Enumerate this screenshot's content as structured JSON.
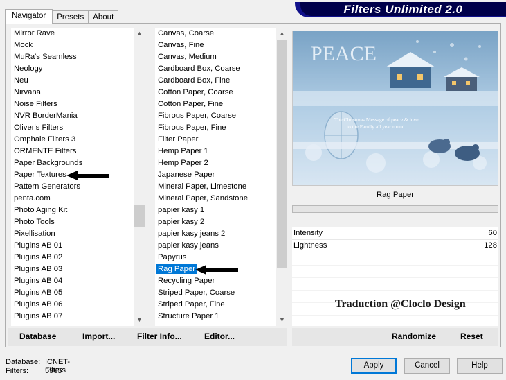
{
  "tabs": [
    "Navigator",
    "Presets",
    "About"
  ],
  "app_title": "Filters Unlimited 2.0",
  "categories": [
    "Mirror Rave",
    "Mock",
    "MuRa's Seamless",
    "Neology",
    "Neu",
    "Nirvana",
    "Noise Filters",
    "NVR BorderMania",
    "Oliver's Filters",
    "Omphale Filters 3",
    "ORMENTE Filters",
    "Paper Backgrounds",
    "Paper Textures",
    "Pattern Generators",
    "penta.com",
    "Photo Aging Kit",
    "Photo Tools",
    "Pixellisation",
    "Plugins AB 01",
    "Plugins AB 02",
    "Plugins AB 03",
    "Plugins AB 04",
    "Plugins AB 05",
    "Plugins AB 06",
    "Plugins AB 07"
  ],
  "filters": [
    "Canvas, Coarse",
    "Canvas, Fine",
    "Canvas, Medium",
    "Cardboard Box, Coarse",
    "Cardboard Box, Fine",
    "Cotton Paper, Coarse",
    "Cotton Paper, Fine",
    "Fibrous Paper, Coarse",
    "Fibrous Paper, Fine",
    "Filter Paper",
    "Hemp Paper 1",
    "Hemp Paper 2",
    "Japanese Paper",
    "Mineral Paper, Limestone",
    "Mineral Paper, Sandstone",
    "papier kasy 1",
    "papier kasy 2",
    "papier kasy jeans 2",
    "papier kasy jeans",
    "Papyrus",
    "Rag Paper",
    "Recycling Paper",
    "Striped Paper, Coarse",
    "Striped Paper, Fine",
    "Structure Paper 1"
  ],
  "selected_filter_index": 20,
  "arrowed_category_index": 12,
  "preview": {
    "title": "PEACE",
    "subtitle_line1": "The Christmas Message of peace & love",
    "subtitle_line2": "to the Family all year round"
  },
  "filter_name": "Rag Paper",
  "parameters": [
    {
      "label": "Intensity",
      "value": "60"
    },
    {
      "label": "Lightness",
      "value": "128"
    }
  ],
  "watermark": "Traduction @Cloclo Design",
  "toolbar": {
    "database_u": "D",
    "database_rest": "atabase",
    "import_pre": "I",
    "import_u": "m",
    "import_rest": "port...",
    "filterinfo_pre": "Filter ",
    "filterinfo_u": "I",
    "filterinfo_rest": "nfo...",
    "editor_u": "E",
    "editor_rest": "ditor...",
    "randomize_pre": "R",
    "randomize_u": "a",
    "randomize_rest": "ndomize",
    "reset_u": "R",
    "reset_rest": "eset"
  },
  "status": {
    "database_label": "Database:",
    "database_value": "ICNET-Filters",
    "filters_label": "Filters:",
    "filters_value": "5965"
  },
  "buttons": {
    "apply": "Apply",
    "cancel": "Cancel",
    "help": "Help"
  },
  "colors": {
    "selection": "#0078d7",
    "banner": "#00004a"
  }
}
